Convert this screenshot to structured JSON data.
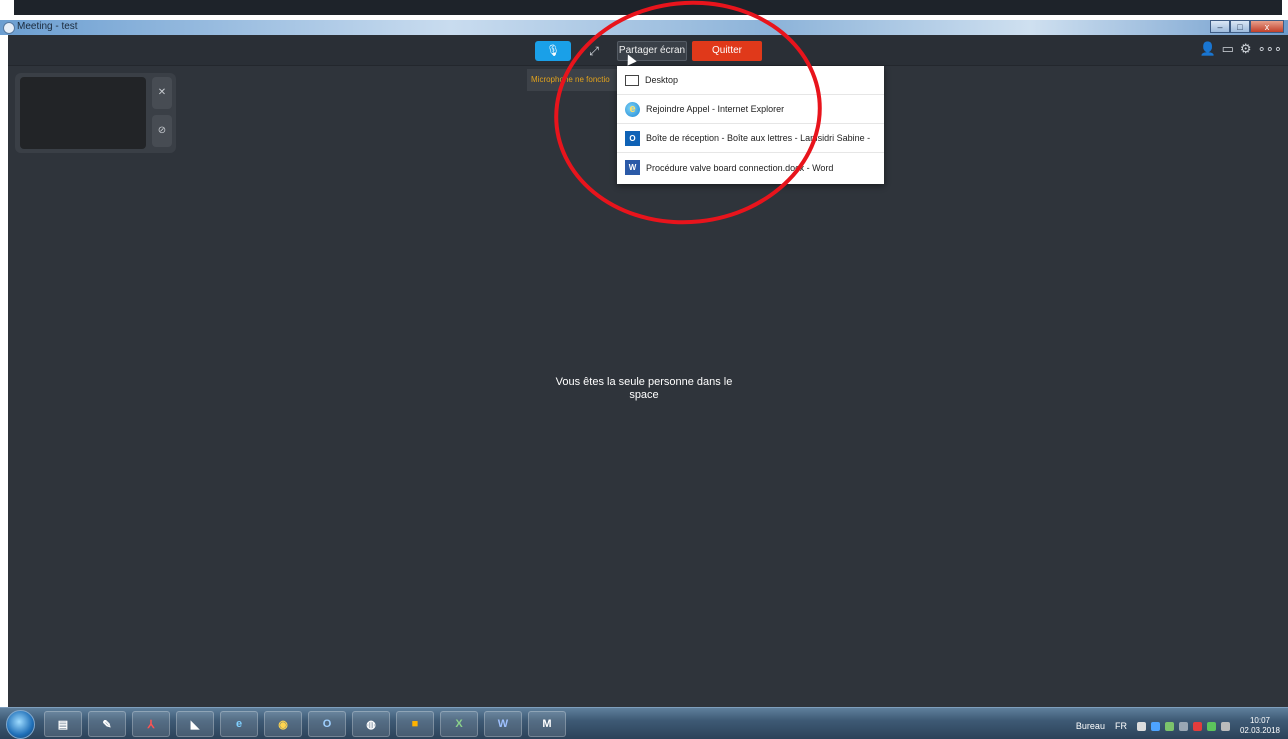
{
  "window": {
    "title": "Meeting - test",
    "controls": {
      "minimize": "–",
      "maximize": "□",
      "close": "x"
    }
  },
  "toolbar": {
    "mic_icon": "microphone-icon",
    "expand_icon": "expand-icon",
    "share_label": "Partager écran",
    "quit_label": "Quitter",
    "right_icons": [
      "participants-icon",
      "screen-icon",
      "settings-icon",
      "more-icon"
    ]
  },
  "mic_warning": "Microphone ne fonctio",
  "share_menu": {
    "items": [
      {
        "label": "Desktop",
        "icon": "desktop-icon"
      },
      {
        "label": "Rejoindre Appel - Internet Explorer",
        "icon": "internet-explorer-icon"
      },
      {
        "label": "Boîte de réception - Boîte aux lettres - Lamsidri Sabine -",
        "icon": "outlook-icon"
      },
      {
        "label": "Procédure valve board connection.docx - Word",
        "icon": "word-icon"
      }
    ]
  },
  "preview": {
    "close_icon": "close-icon",
    "video_off_icon": "video-off-icon"
  },
  "main": {
    "message": "Vous êtes la seule personne dans le space"
  },
  "taskbar": {
    "apps": [
      "explorer-icon",
      "paint-icon",
      "pdf-icon",
      "onenote-icon",
      "internet-explorer-icon",
      "chrome-icon",
      "outlook-icon",
      "globe-icon",
      "media-icon",
      "excel-icon",
      "word-icon",
      "meeting-icon"
    ],
    "tray_label": "Bureau",
    "lang": "FR",
    "time": "10:07",
    "date": "02.03.2018"
  },
  "colors": {
    "app_bg": "#2f343b",
    "mic_blue": "#1aa0e8",
    "quit_red": "#e0391a",
    "warning_text": "#e1a21c",
    "annotation_red": "#e8141c"
  }
}
